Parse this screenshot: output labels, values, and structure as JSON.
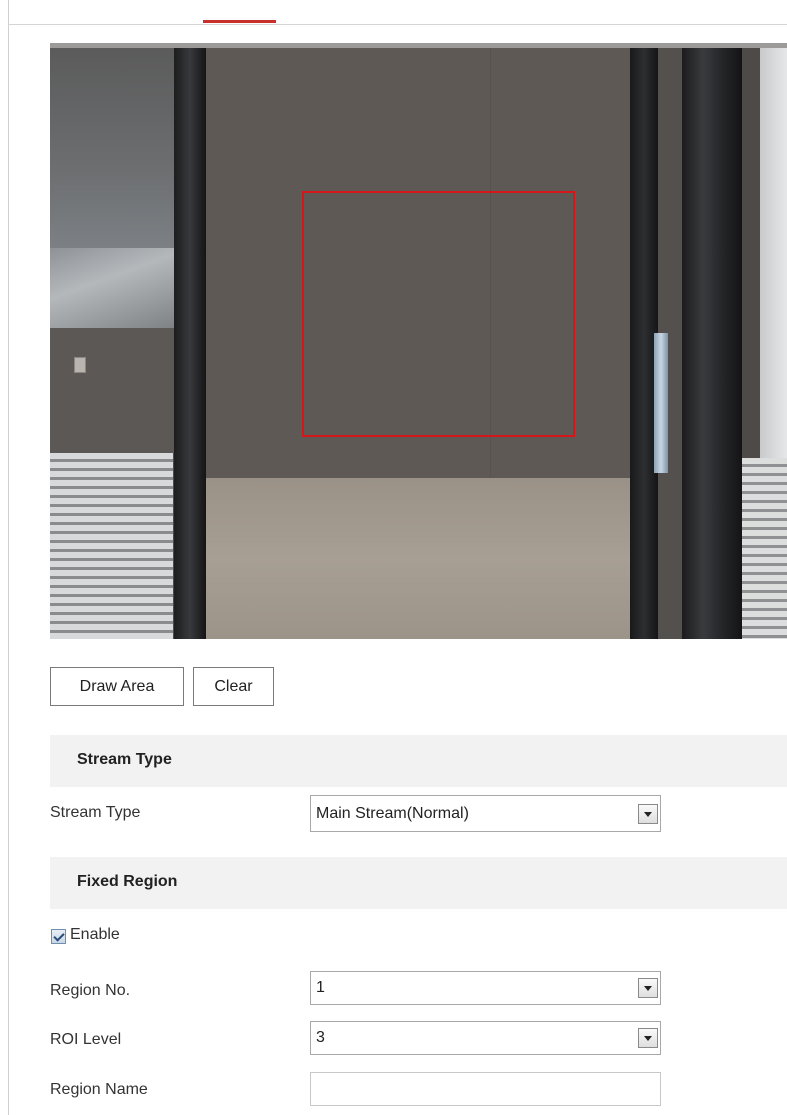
{
  "video": {
    "accent_color": "#d5171b"
  },
  "buttons": {
    "draw_area": "Draw Area",
    "clear": "Clear"
  },
  "stream_section": {
    "title": "Stream Type",
    "label": "Stream Type",
    "value": "Main Stream(Normal)"
  },
  "fixed_region_section": {
    "title": "Fixed Region",
    "enable_label": "Enable",
    "enable_checked": true,
    "region_no_label": "Region No.",
    "region_no_value": "1",
    "roi_level_label": "ROI Level",
    "roi_level_value": "3",
    "region_name_label": "Region Name",
    "region_name_value": ""
  },
  "colors": {
    "section_bg": "#f2f2f2",
    "tab_active": "#c9302c"
  }
}
